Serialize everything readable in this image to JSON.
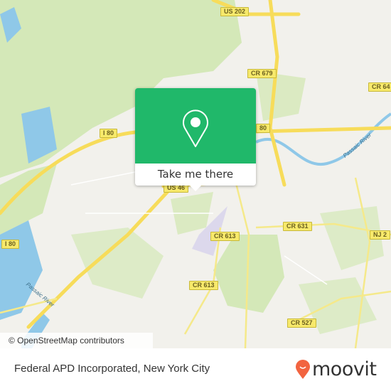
{
  "map": {
    "road_labels": [
      "US 202",
      "CR 679",
      "CR 64",
      "I 80",
      "80",
      "I 80",
      "US 46",
      "CR 613",
      "CR 613",
      "CR 631",
      "NJ 2",
      "CR 527"
    ],
    "river_labels": [
      "Passaic River",
      "Passaic River"
    ],
    "attribution": "© OpenStreetMap contributors",
    "colors": {
      "land": "#f2f1ec",
      "park": "#d4e8b8",
      "water": "#8fc8e8",
      "highway": "#f7dc5a",
      "popup": "#20b86a"
    }
  },
  "popup": {
    "icon": "map-pin-icon",
    "button_label": "Take me there"
  },
  "footer": {
    "place_name": "Federal APD Incorporated, New York City",
    "logo_text": "moovit",
    "logo_icon": "moovit-pin-icon",
    "logo_color": "#f26440"
  }
}
